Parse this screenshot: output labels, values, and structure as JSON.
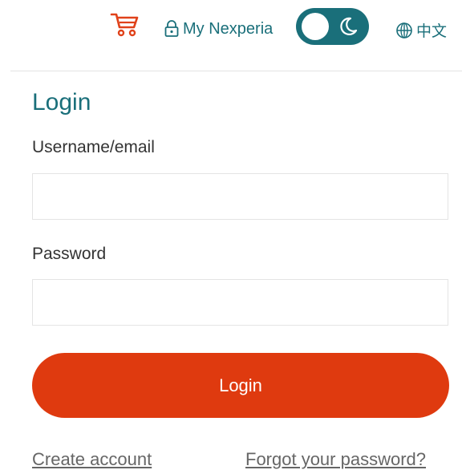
{
  "header": {
    "cart_icon": "cart-icon",
    "my_account_label": "My Nexperia",
    "lock_icon": "lock-icon",
    "theme_toggle_icon": "moon-icon",
    "language_label": "中文",
    "globe_icon": "globe-icon"
  },
  "login": {
    "title": "Login",
    "username_label": "Username/email",
    "username_value": "",
    "password_label": "Password",
    "password_value": "",
    "submit_label": "Login",
    "create_account_label": "Create account",
    "forgot_password_label": "Forgot your password?"
  },
  "colors": {
    "accent": "#1a6f7a",
    "primary_button": "#df3a0f",
    "cart_icon": "#e0421a"
  }
}
